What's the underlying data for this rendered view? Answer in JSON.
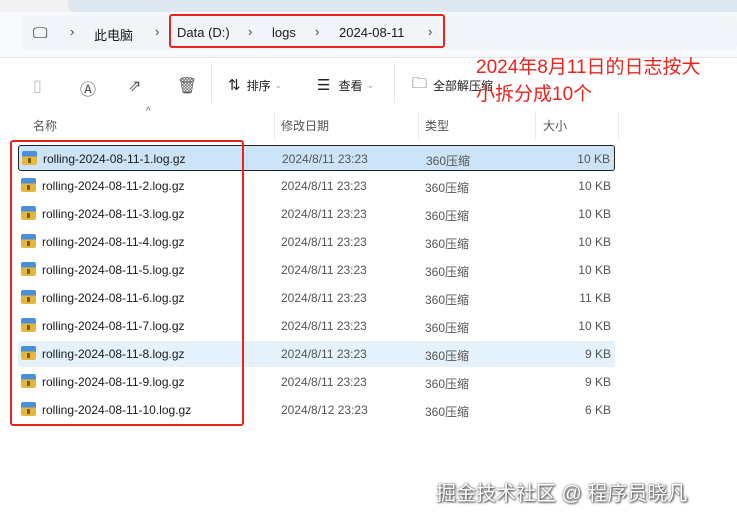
{
  "breadcrumb": {
    "items": [
      "此电脑",
      "Data (D:)",
      "logs",
      "2024-08-11"
    ]
  },
  "toolbar": {
    "sort": "排序",
    "view": "查看",
    "extract_all": "全部解压缩",
    "more": "..."
  },
  "annotation": {
    "line1": "2024年8月11日的日志按大",
    "line2": "小拆分成10个"
  },
  "columns": {
    "name": "名称",
    "date": "修改日期",
    "type": "类型",
    "size": "大小"
  },
  "files": [
    {
      "name": "rolling-2024-08-11-1.log.gz",
      "date": "2024/8/11 23:23",
      "type": "360压缩",
      "size": "10 KB"
    },
    {
      "name": "rolling-2024-08-11-2.log.gz",
      "date": "2024/8/11 23:23",
      "type": "360压缩",
      "size": "10 KB"
    },
    {
      "name": "rolling-2024-08-11-3.log.gz",
      "date": "2024/8/11 23:23",
      "type": "360压缩",
      "size": "10 KB"
    },
    {
      "name": "rolling-2024-08-11-4.log.gz",
      "date": "2024/8/11 23:23",
      "type": "360压缩",
      "size": "10 KB"
    },
    {
      "name": "rolling-2024-08-11-5.log.gz",
      "date": "2024/8/11 23:23",
      "type": "360压缩",
      "size": "10 KB"
    },
    {
      "name": "rolling-2024-08-11-6.log.gz",
      "date": "2024/8/11 23:23",
      "type": "360压缩",
      "size": "11 KB"
    },
    {
      "name": "rolling-2024-08-11-7.log.gz",
      "date": "2024/8/11 23:23",
      "type": "360压缩",
      "size": "10 KB"
    },
    {
      "name": "rolling-2024-08-11-8.log.gz",
      "date": "2024/8/11 23:23",
      "type": "360压缩",
      "size": "9 KB"
    },
    {
      "name": "rolling-2024-08-11-9.log.gz",
      "date": "2024/8/11 23:23",
      "type": "360压缩",
      "size": "9 KB"
    },
    {
      "name": "rolling-2024-08-11-10.log.gz",
      "date": "2024/8/12 23:23",
      "type": "360压缩",
      "size": "6 KB"
    }
  ],
  "watermark": "掘金技术社区 @ 程序员晓凡",
  "colors": {
    "annotation": "#e8241c",
    "selected": "#cce4f7",
    "hover": "#e5f1fb"
  }
}
